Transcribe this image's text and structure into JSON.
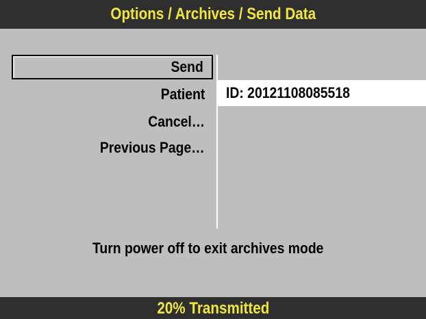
{
  "header": {
    "title": "Options / Archives / Send Data"
  },
  "menu": {
    "items": [
      {
        "label": "Send",
        "selected": true
      },
      {
        "label": "Patient",
        "selected": false
      },
      {
        "label": "Cancel…",
        "selected": false
      },
      {
        "label": "Previous Page…",
        "selected": false
      }
    ]
  },
  "patient": {
    "id_value": "ID: 20121108085518"
  },
  "hint": {
    "text": "Turn power off to exit archives mode"
  },
  "status": {
    "text": "20% Transmitted",
    "progress_percent": 20
  },
  "colors": {
    "background": "#bebebe",
    "bar_background": "#2f2f2f",
    "bar_text": "#f0e63c",
    "field_background": "#ffffff"
  }
}
